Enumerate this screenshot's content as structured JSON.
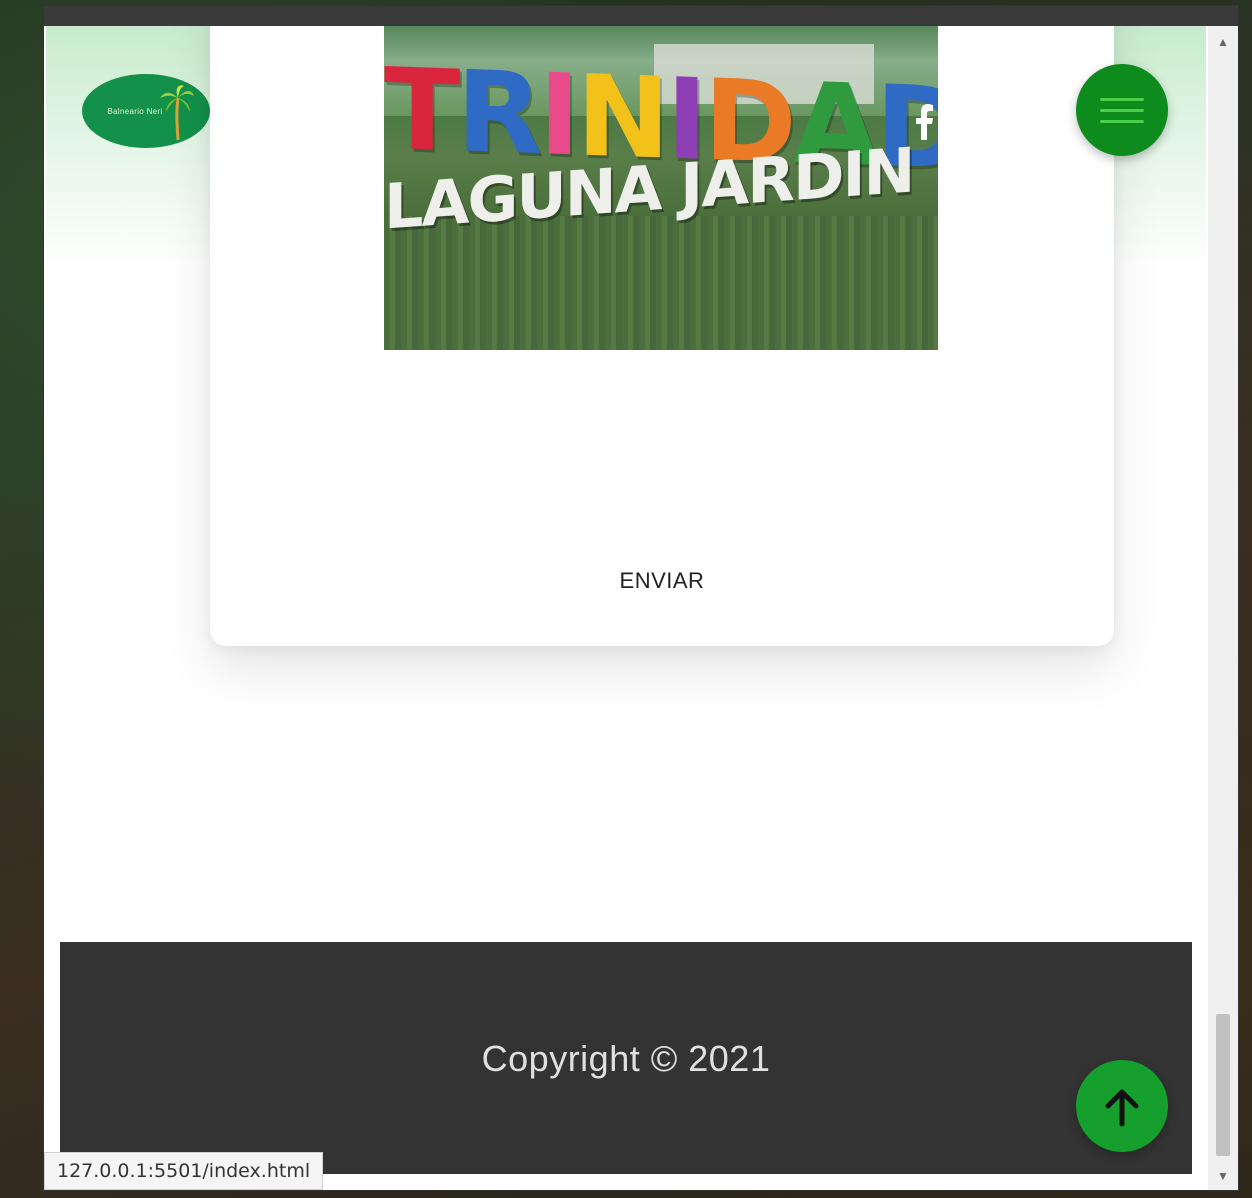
{
  "colors": {
    "brand_green": "#13914a",
    "menu_green": "#0d8b1c",
    "footer_bg": "#333333",
    "top_button": "#15a02d"
  },
  "header": {
    "logo_text": "Balneario Neri",
    "social_icons": [
      "facebook-icon",
      "instagram-icon",
      "twitter-icon"
    ],
    "menu_icon": "hamburger-icon"
  },
  "card": {
    "photo": {
      "sign_line1": [
        "T",
        "R",
        "I",
        "N",
        "I",
        "D",
        "A",
        "D"
      ],
      "sign_line2": "LAGUNA JARDIN"
    },
    "submit_label": "ENVIAR"
  },
  "footer": {
    "copyright": "Copyright © 2021",
    "scroll_top_icon": "arrow-up-icon"
  },
  "statusbar": {
    "url": "127.0.0.1:5501/index.html"
  }
}
